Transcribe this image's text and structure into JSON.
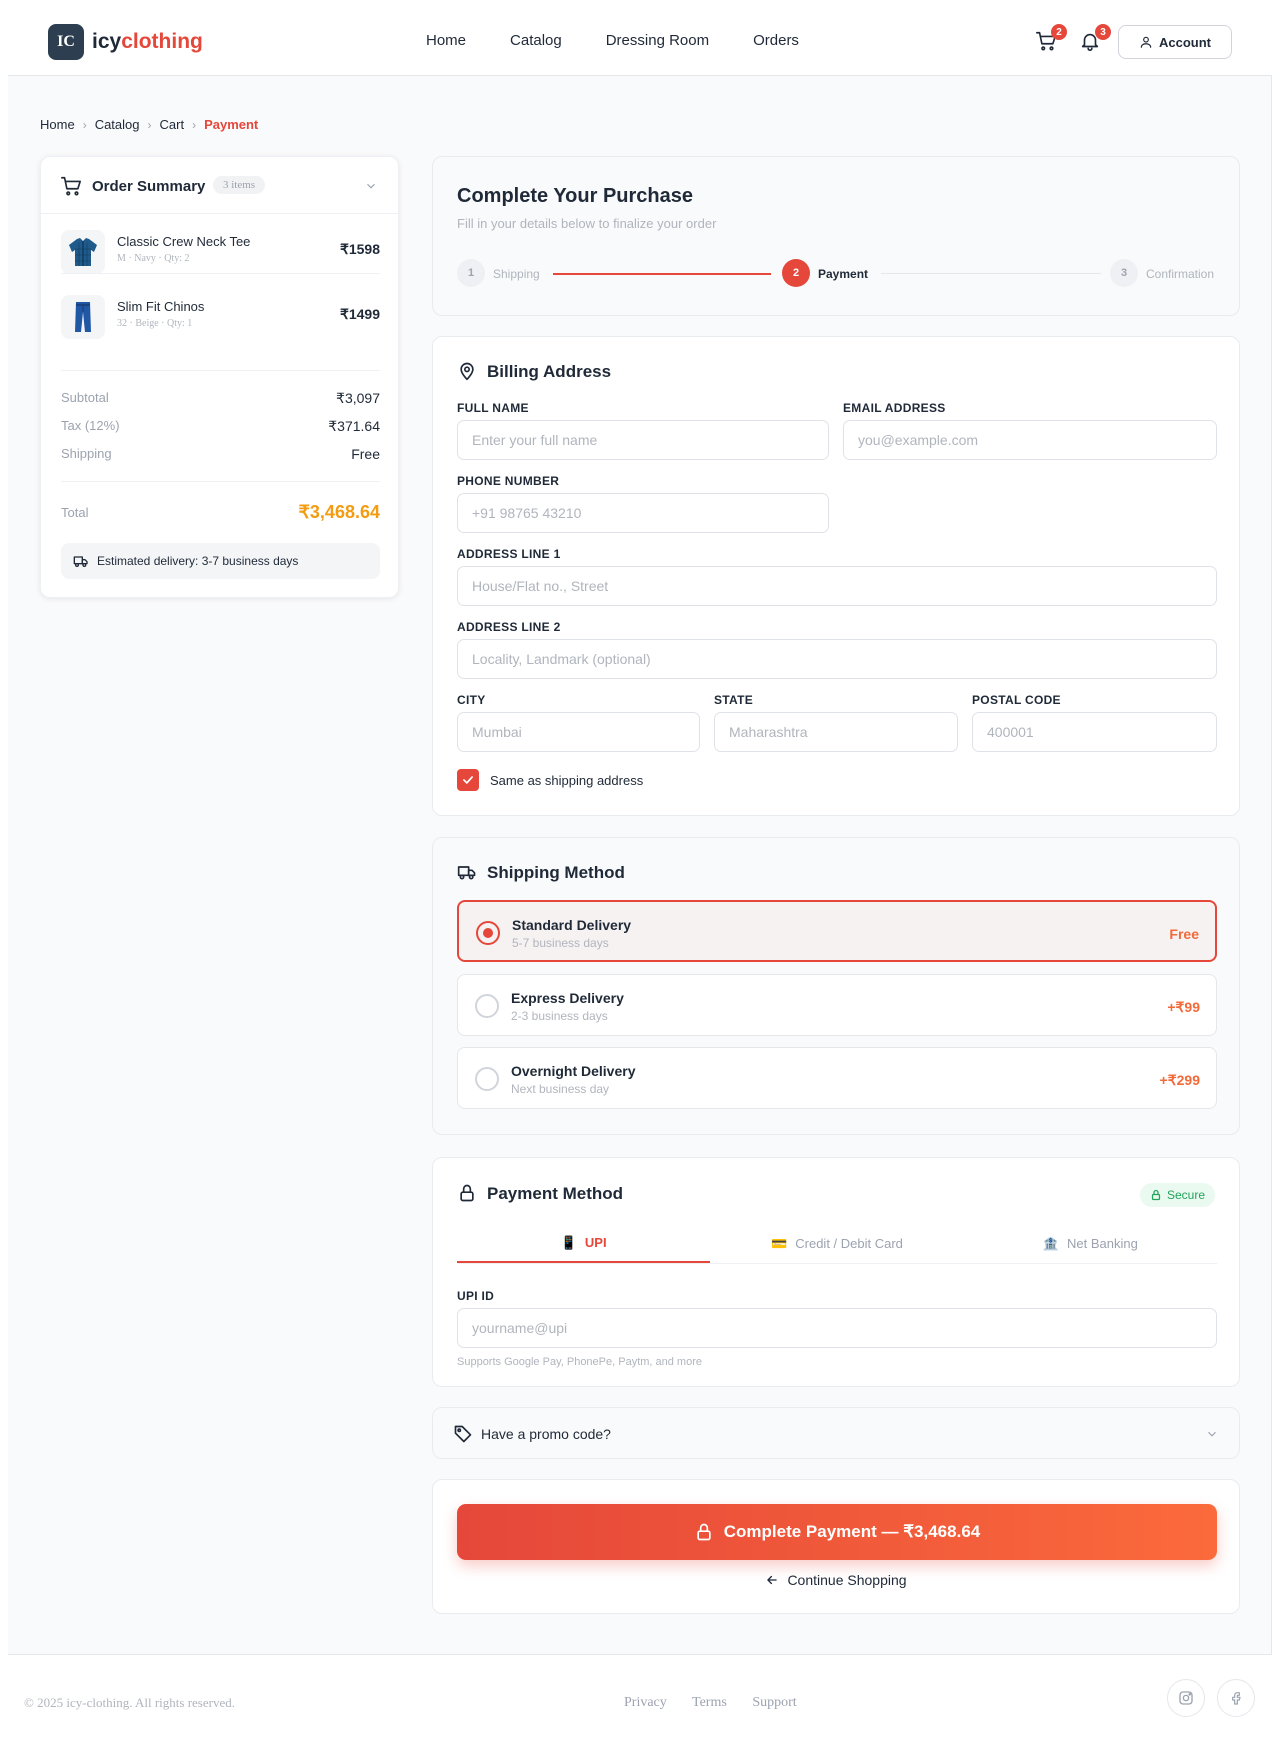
{
  "brand": {
    "logo_initials": "IC",
    "name_part1": "icy",
    "name_part2": "clothing"
  },
  "nav": [
    "Home",
    "Catalog",
    "Dressing Room",
    "Orders"
  ],
  "header": {
    "cart_count": "2",
    "notif_count": "3",
    "account_label": "Account"
  },
  "breadcrumb": [
    "Home",
    "Catalog",
    "Cart",
    "Payment"
  ],
  "summary": {
    "title": "Order Summary",
    "count": "3 items",
    "items": [
      {
        "name": "Classic Crew Neck Tee",
        "meta": "M · Navy · Qty: 2",
        "price": "₹1598"
      },
      {
        "name": "Slim Fit Chinos",
        "meta": "32 · Beige · Qty: 1",
        "price": "₹1499"
      }
    ],
    "subtotal_label": "Subtotal",
    "subtotal": "₹3,097",
    "tax_label": "Tax (12%)",
    "tax": "₹371.64",
    "shipping_label": "Shipping",
    "shipping": "Free",
    "total_label": "Total",
    "total": "₹3,468.64",
    "delivery": "Estimated delivery: 3-7 business days"
  },
  "purchase": {
    "title": "Complete Your Purchase",
    "subtitle": "Fill in your details below to finalize your order",
    "steps": [
      {
        "num": "1",
        "label": "Shipping"
      },
      {
        "num": "2",
        "label": "Payment"
      },
      {
        "num": "3",
        "label": "Confirmation"
      }
    ]
  },
  "billing": {
    "title": "Billing Address",
    "full_name_label": "FULL NAME",
    "full_name_ph": "Enter your full name",
    "email_label": "EMAIL ADDRESS",
    "email_ph": "you@example.com",
    "phone_label": "PHONE NUMBER",
    "phone_ph": "+91 98765 43210",
    "addr1_label": "ADDRESS LINE 1",
    "addr1_ph": "House/Flat no., Street",
    "addr2_label": "ADDRESS LINE 2",
    "addr2_ph": "Locality, Landmark (optional)",
    "city_label": "CITY",
    "city_ph": "Mumbai",
    "state_label": "STATE",
    "state_ph": "Maharashtra",
    "postal_label": "POSTAL CODE",
    "postal_ph": "400001",
    "same_label": "Same as shipping address"
  },
  "shipping": {
    "title": "Shipping Method",
    "options": [
      {
        "title": "Standard Delivery",
        "sub": "5-7 business days",
        "price": "Free"
      },
      {
        "title": "Express Delivery",
        "sub": "2-3 business days",
        "price": "+₹99"
      },
      {
        "title": "Overnight Delivery",
        "sub": "Next business day",
        "price": "+₹299"
      }
    ]
  },
  "payment": {
    "title": "Payment Method",
    "secure": "Secure",
    "tabs": [
      {
        "icon": "📱",
        "label": "UPI"
      },
      {
        "icon": "💳",
        "label": "Credit / Debit Card"
      },
      {
        "icon": "🏦",
        "label": "Net Banking"
      }
    ],
    "upi_label": "UPI ID",
    "upi_ph": "yourname@upi",
    "upi_hint": "Supports Google Pay, PhonePe, Paytm, and more"
  },
  "promo": {
    "label": "Have a promo code?"
  },
  "actions": {
    "pay": "Complete Payment — ₹3,468.64",
    "continue": "Continue Shopping"
  },
  "footer": {
    "copyright": "© 2025 icy-clothing. All rights reserved.",
    "links": [
      "Privacy",
      "Terms",
      "Support"
    ]
  },
  "colors": {
    "accent": "#e5473a",
    "orange": "#f39c12",
    "dark": "#2d3e50"
  }
}
